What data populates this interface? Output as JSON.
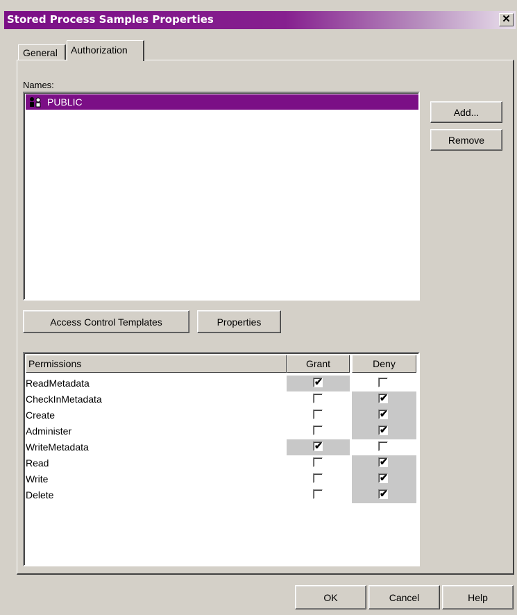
{
  "window": {
    "title": "Stored Process Samples Properties",
    "close_glyph": "✕"
  },
  "tabs": [
    {
      "label": "General",
      "active": false
    },
    {
      "label": "Authorization",
      "active": true
    }
  ],
  "names": {
    "label": "Names:",
    "items": [
      {
        "label": "PUBLIC",
        "icon": "group-icon",
        "selected": true
      }
    ],
    "add_label": "Add...",
    "remove_label": "Remove",
    "act_label": "Access Control Templates",
    "properties_label": "Properties"
  },
  "permissions": {
    "columns": [
      "Permissions",
      "Grant",
      "Deny"
    ],
    "rows": [
      {
        "name": "ReadMetadata",
        "grant": true,
        "deny": false
      },
      {
        "name": "CheckInMetadata",
        "grant": false,
        "deny": true
      },
      {
        "name": "Create",
        "grant": false,
        "deny": true
      },
      {
        "name": "Administer",
        "grant": false,
        "deny": true
      },
      {
        "name": "WriteMetadata",
        "grant": true,
        "deny": false
      },
      {
        "name": "Read",
        "grant": false,
        "deny": true
      },
      {
        "name": "Write",
        "grant": false,
        "deny": true
      },
      {
        "name": "Delete",
        "grant": false,
        "deny": true
      }
    ],
    "check_glyph": "✔"
  },
  "footer": {
    "ok_label": "OK",
    "cancel_label": "Cancel",
    "help_label": "Help"
  },
  "colors": {
    "accent": "#7b0f86",
    "face": "#d4d0c8",
    "checked_cell": "#c8c8c8"
  }
}
